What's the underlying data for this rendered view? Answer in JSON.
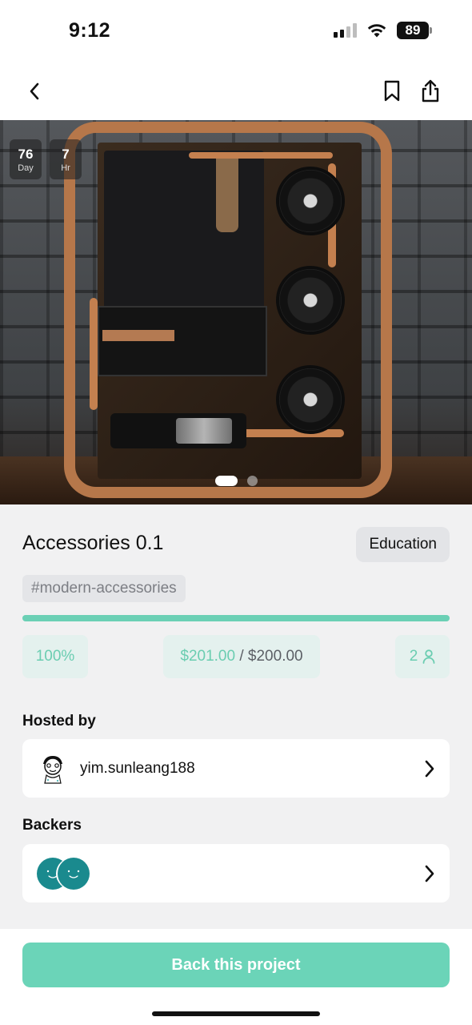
{
  "status_bar": {
    "time": "9:12",
    "battery": "89"
  },
  "nav": {
    "back_icon": "chevron-left-icon",
    "bookmark_icon": "bookmark-icon",
    "share_icon": "share-icon"
  },
  "hero": {
    "countdown": [
      {
        "value": "76",
        "unit": "Day"
      },
      {
        "value": "7",
        "unit": "Hr"
      }
    ],
    "carousel": {
      "total": 2,
      "active": 1
    }
  },
  "project": {
    "title": "Accessories 0.1",
    "category": "Education",
    "tag": "#modern-accessories",
    "progress_fraction": 1.0,
    "percent_label": "100%",
    "raised": "$201.00",
    "separator": " / ",
    "goal": "$200.00",
    "backers_count": "2"
  },
  "hosted": {
    "label": "Hosted by",
    "username": "yim.sunleang188"
  },
  "backers": {
    "label": "Backers"
  },
  "cta": {
    "label": "Back this project"
  },
  "colors": {
    "accent": "#6bd4b8",
    "accent_text": "#6bcdb1",
    "stat_bg": "#e4f1ee",
    "page_bg": "#f1f1f2"
  }
}
